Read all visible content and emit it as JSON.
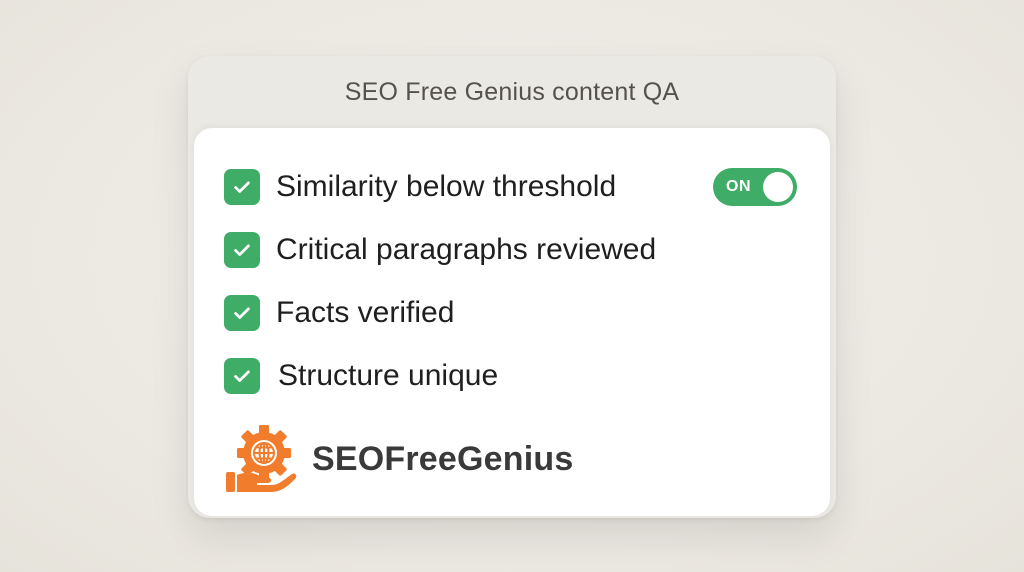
{
  "window": {
    "title": "SEO Free Genius content QA"
  },
  "checklist": [
    {
      "label": "Similarity below threshold",
      "checked": true
    },
    {
      "label": "Critical paragraphs reviewed",
      "checked": true
    },
    {
      "label": "Facts verified",
      "checked": true
    },
    {
      "label": "Structure unique",
      "checked": true
    }
  ],
  "toggle": {
    "label": "ON",
    "state": "on"
  },
  "brand": {
    "name": "SEOFreeGenius",
    "logo_icon": "gear-globe-hand-icon"
  },
  "colors": {
    "accent_green": "#3fac67",
    "brand_orange": "#f07c2c",
    "text_dark": "#1f1f1f"
  }
}
